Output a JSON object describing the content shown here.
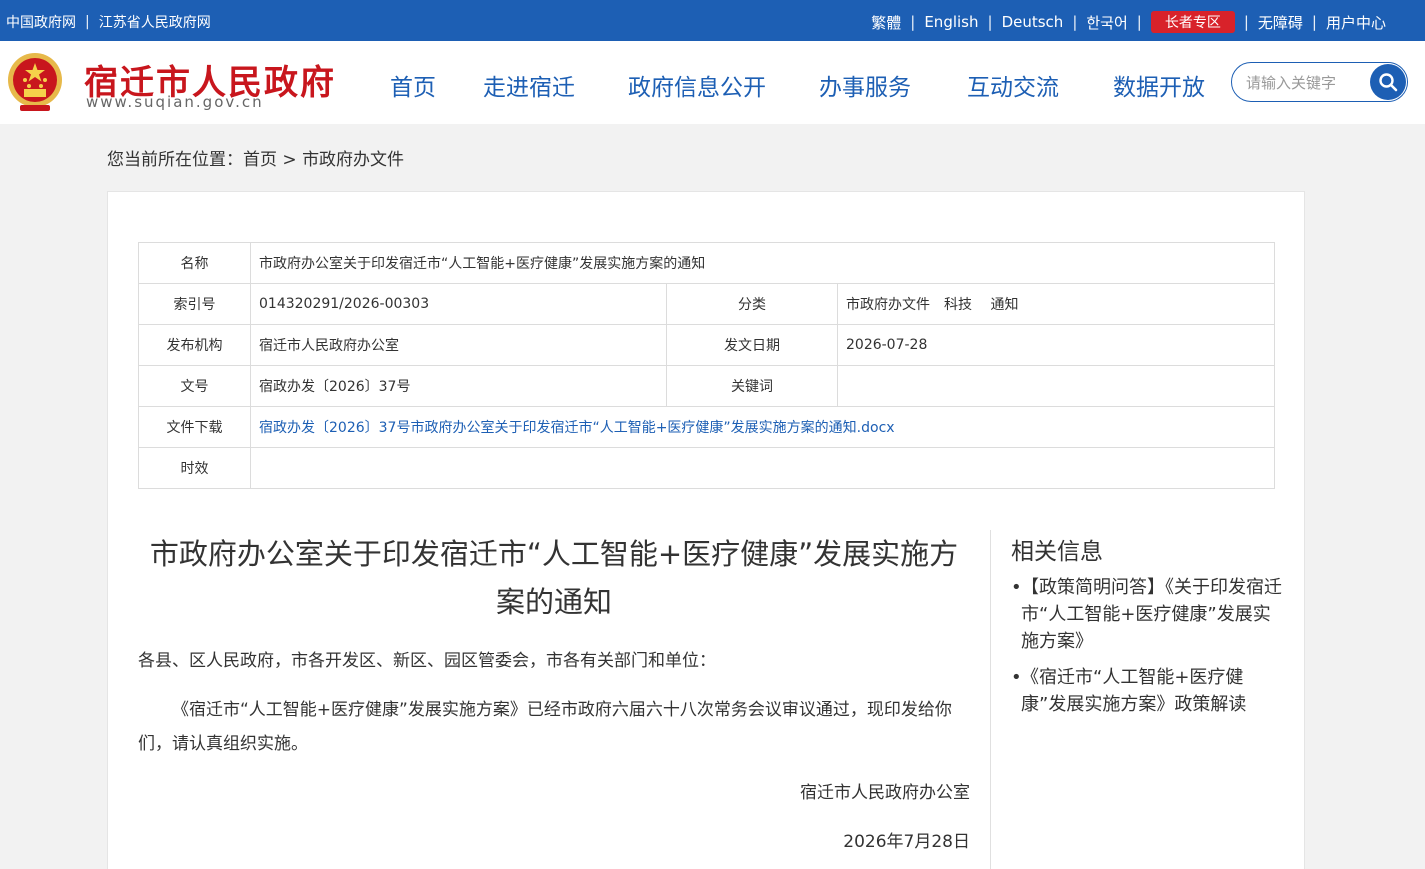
{
  "topbar": {
    "left_links": [
      "中国政府网",
      "江苏省人民政府网"
    ],
    "right_links": [
      "繁體",
      "English",
      "Deutsch",
      "한국어"
    ],
    "elder": "长者专区",
    "extra_links": [
      "无障碍",
      "用户中心"
    ]
  },
  "header": {
    "title": "宿迁市人民政府",
    "url": "www.suqian.gov.cn",
    "nav": [
      "首页",
      "走进宿迁",
      "政府信息公开",
      "办事服务",
      "互动交流",
      "数据开放"
    ],
    "search_placeholder": "请输入关键字"
  },
  "breadcrumb": {
    "prefix": "您当前所在位置：",
    "home": "首页",
    "sep": " > ",
    "current": "市政府办文件"
  },
  "meta": {
    "name_label": "名称",
    "name_value": "市政府办公室关于印发宿迁市“人工智能+医疗健康”发展实施方案的通知",
    "index_label": "索引号",
    "index_value": "014320291/2026-00303",
    "category_label": "分类",
    "category_value": "市政府办文件　科技　 通知",
    "org_label": "发布机构",
    "org_value": "宿迁市人民政府办公室",
    "date_label": "发文日期",
    "date_value": "2026-07-28",
    "docno_label": "文号",
    "docno_value": "宿政办发〔2026〕37号",
    "keywords_label": "关键词",
    "keywords_value": "",
    "download_label": "文件下载",
    "download_value": "宿政办发〔2026〕37号市政府办公室关于印发宿迁市“人工智能+医疗健康”发展实施方案的通知.docx",
    "validity_label": "时效",
    "validity_value": ""
  },
  "article": {
    "title": "市政府办公室关于印发宿迁市“人工智能+医疗健康”发展实施方案的通知",
    "salutation": "各县、区人民政府，市各开发区、新区、园区管委会，市各有关部门和单位：",
    "body": "《宿迁市“人工智能+医疗健康”发展实施方案》已经市政府六届六十八次常务会议审议通过，现印发给你们，请认真组织实施。",
    "issuer": "宿迁市人民政府办公室",
    "date": "2026年7月28日"
  },
  "related": {
    "title": "相关信息",
    "items": [
      "【政策简明问答】《关于印发宿迁市“人工智能+医疗健康”发展实施方案》",
      "《宿迁市“人工智能+医疗健康”发展实施方案》政策解读"
    ]
  }
}
